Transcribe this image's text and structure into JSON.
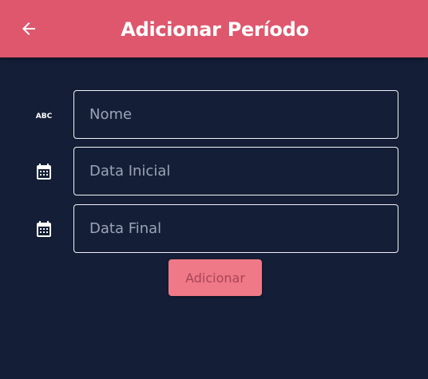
{
  "appbar": {
    "title": "Adicionar Período",
    "back_icon": "arrow-left-icon"
  },
  "form": {
    "fields": [
      {
        "icon": "abc-text-icon",
        "icon_text": "ABC",
        "placeholder": "Nome",
        "value": ""
      },
      {
        "icon": "calendar-icon",
        "placeholder": "Data Inicial",
        "value": ""
      },
      {
        "icon": "calendar-icon",
        "placeholder": "Data Final",
        "value": ""
      }
    ],
    "submit_label": "Adicionar"
  },
  "colors": {
    "appbar": "#de576d",
    "background": "#141e36",
    "button": "#ef7986",
    "button_text": "#a94558"
  }
}
